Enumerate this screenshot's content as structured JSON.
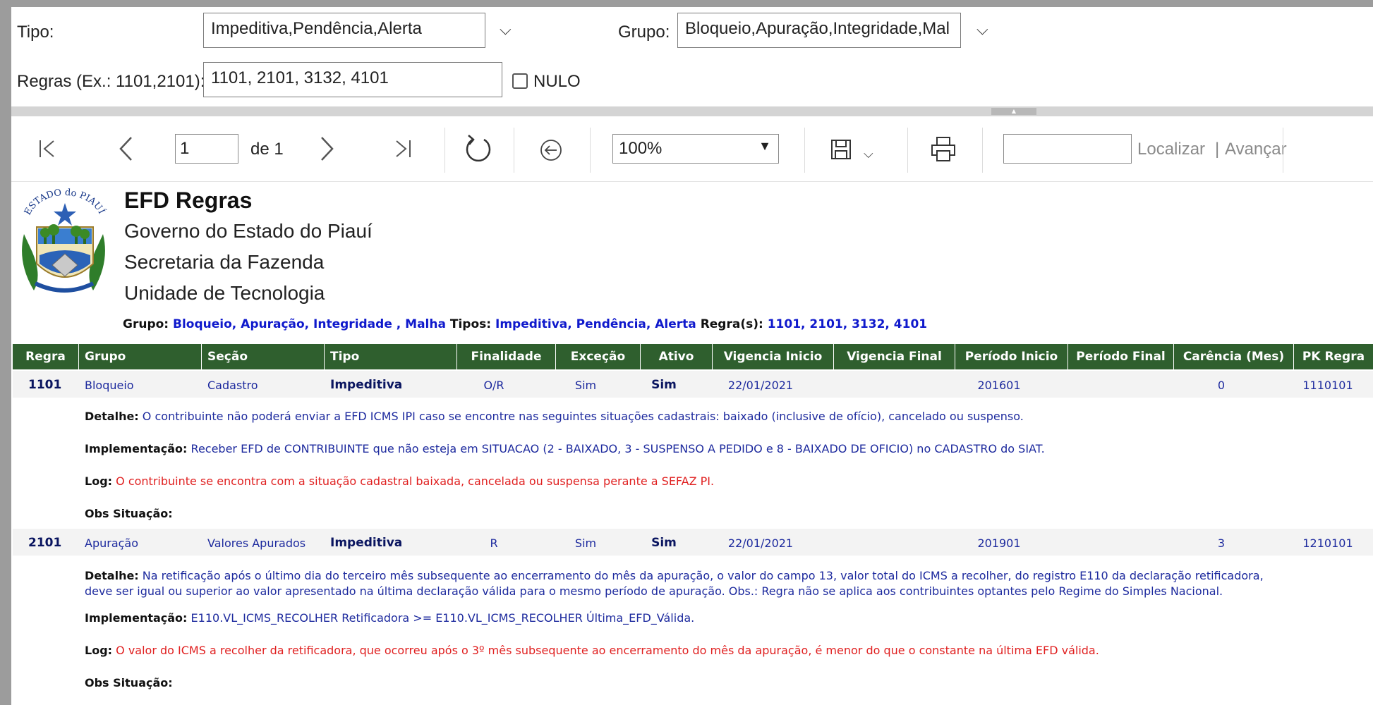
{
  "params": {
    "tipo_label": "Tipo:",
    "tipo_value": "Impeditiva,Pendência,Alerta",
    "grupo_label": "Grupo:",
    "grupo_value": "Bloqueio,Apuração,Integridade,Mal",
    "regras_label": "Regras (Ex.: 1101,2101):",
    "regras_value": "1101, 2101, 3132, 4101",
    "nulo_label": "NULO"
  },
  "toolbar": {
    "page_value": "1",
    "page_of": "de 1",
    "zoom": "100%",
    "find_label": "Localizar",
    "separator": "|",
    "next_label": "Avançar"
  },
  "report": {
    "title": "EFD Regras",
    "line1": "Governo do Estado do Piauí",
    "line2": "Secretaria da Fazenda",
    "line3": "Unidade de Tecnologia",
    "logo_text": "ESTADO do PIAUÍ",
    "filter_grupo_label": "Grupo:",
    "filter_grupo_value": "Bloqueio, Apuração, Integridade , Malha",
    "filter_tipos_label": "Tipos:",
    "filter_tipos_value": "Impeditiva, Pendência, Alerta",
    "filter_regras_label": "Regra(s):",
    "filter_regras_value": "1101, 2101, 3132, 4101"
  },
  "table": {
    "columns": [
      "Regra",
      "Grupo",
      "Seção",
      "Tipo",
      "Finalidade",
      "Exceção",
      "Ativo",
      "Vigencia Inicio",
      "Vigencia Final",
      "Período Inicio",
      "Período Final",
      "Carência (Mes)",
      "PK Regra"
    ],
    "detail_labels": {
      "detalhe": "Detalhe:",
      "implementacao": "Implementação:",
      "log": "Log:",
      "obs": "Obs Situação:"
    },
    "rows": [
      {
        "regra": "1101",
        "grupo": "Bloqueio",
        "secao": "Cadastro",
        "tipo": "Impeditiva",
        "finalidade": "O/R",
        "excecao": "Sim",
        "ativo": "Sim",
        "vigencia_inicio": "22/01/2021",
        "vigencia_final": "",
        "periodo_inicio": "201601",
        "periodo_final": "",
        "carencia": "0",
        "pk_regra": "1110101",
        "detalhe": "O contribuinte não poderá enviar a EFD ICMS IPI caso se encontre nas seguintes situações cadastrais: baixado (inclusive de ofício), cancelado ou suspenso.",
        "implementacao": "Receber EFD de CONTRIBUINTE que não esteja em SITUACAO (2 - BAIXADO, 3 - SUSPENSO A PEDIDO e 8 - BAIXADO DE OFICIO) no CADASTRO do SIAT.",
        "log": "O contribuinte se encontra com a situação cadastral baixada, cancelada ou suspensa perante a SEFAZ PI.",
        "obs": ""
      },
      {
        "regra": "2101",
        "grupo": "Apuração",
        "secao": "Valores Apurados",
        "tipo": "Impeditiva",
        "finalidade": "R",
        "excecao": "Sim",
        "ativo": "Sim",
        "vigencia_inicio": "22/01/2021",
        "vigencia_final": "",
        "periodo_inicio": "201901",
        "periodo_final": "",
        "carencia": "3",
        "pk_regra": "1210101",
        "detalhe_line1": "Na retificação após o último dia do terceiro mês subsequente ao encerramento do mês da apuração, o valor do campo 13, valor total do ICMS a recolher, do registro E110 da declaração retificadora,",
        "detalhe_line2": "deve ser igual ou superior ao valor apresentado na última declaração válida para o mesmo período de apuração.  Obs.: Regra não se aplica aos contribuintes optantes pelo Regime do Simples Nacional.",
        "implementacao": "E110.VL_ICMS_RECOLHER Retificadora >= E110.VL_ICMS_RECOLHER Última_EFD_Válida.",
        "log": "O valor do ICMS a recolher da retificadora, que ocorreu após o 3º mês subsequente ao encerramento do mês da apuração, é menor do que o constante na última EFD válida.",
        "obs": ""
      }
    ]
  }
}
